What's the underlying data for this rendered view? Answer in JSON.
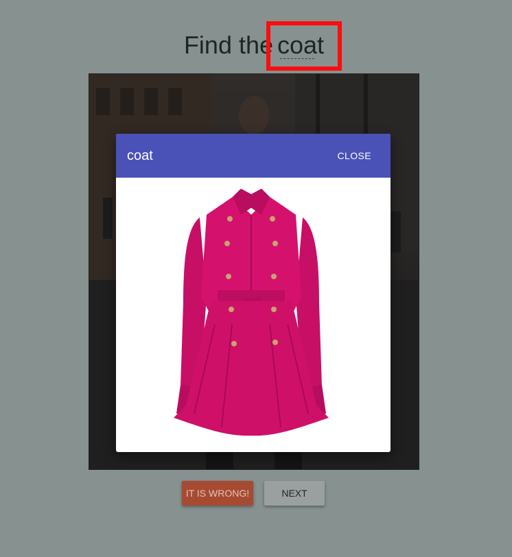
{
  "heading": {
    "prefix": "Find the",
    "target_word": "coat"
  },
  "modal": {
    "title": "coat",
    "close_label": "CLOSE",
    "image_alt": "coat",
    "item_color": "#d4126d"
  },
  "buttons": {
    "wrong_label": "IT IS WRONG!",
    "next_label": "NEXT"
  },
  "colors": {
    "background": "#869190",
    "modal_header": "#4a52b8",
    "highlight": "#ff0c0c",
    "wrong_button": "#a64b32",
    "next_button": "#9aa0a0"
  }
}
